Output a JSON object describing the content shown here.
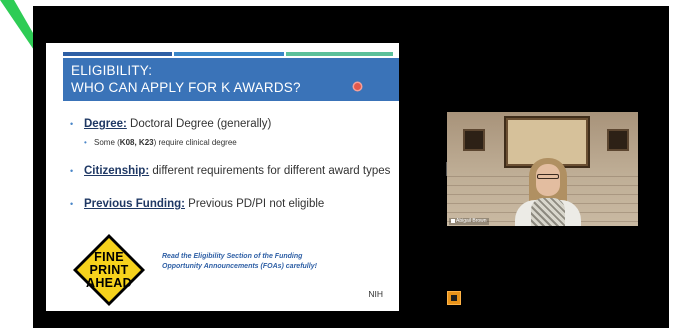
{
  "slide": {
    "title_line1": "ELIGIBILITY:",
    "title_line2": "WHO CAN APPLY FOR K AWARDS?",
    "bullets": [
      {
        "key": "Degree:",
        "text": " Doctoral Degree (generally)"
      },
      {
        "key": "Citizenship:",
        "text": " different requirements for different award types"
      },
      {
        "key": "Previous Funding:",
        "text": " Previous PD/PI not eligible"
      }
    ],
    "sub_bullet": {
      "prefix": "Some (",
      "bold": "K08, K23",
      "suffix": ")  require clinical degree"
    },
    "sign": {
      "line1": "FINE",
      "line2": "PRINT",
      "line3": "AHEAD"
    },
    "note_line1": "Read the Eligibility Section of the Funding",
    "note_line2": "Opportunity Announcements (FOAs) carefully!",
    "footer": "NIH"
  },
  "video": {
    "participant_name": "Abigail Brown"
  },
  "colors": {
    "title_band": "#3a73b8",
    "accent_green": "#5bc09a",
    "note_text": "#2e5fa5",
    "sign_yellow": "#f6d21c"
  },
  "icons": {
    "signal": "signal-strength-icon",
    "small_tile": "self-view-tile-icon"
  }
}
